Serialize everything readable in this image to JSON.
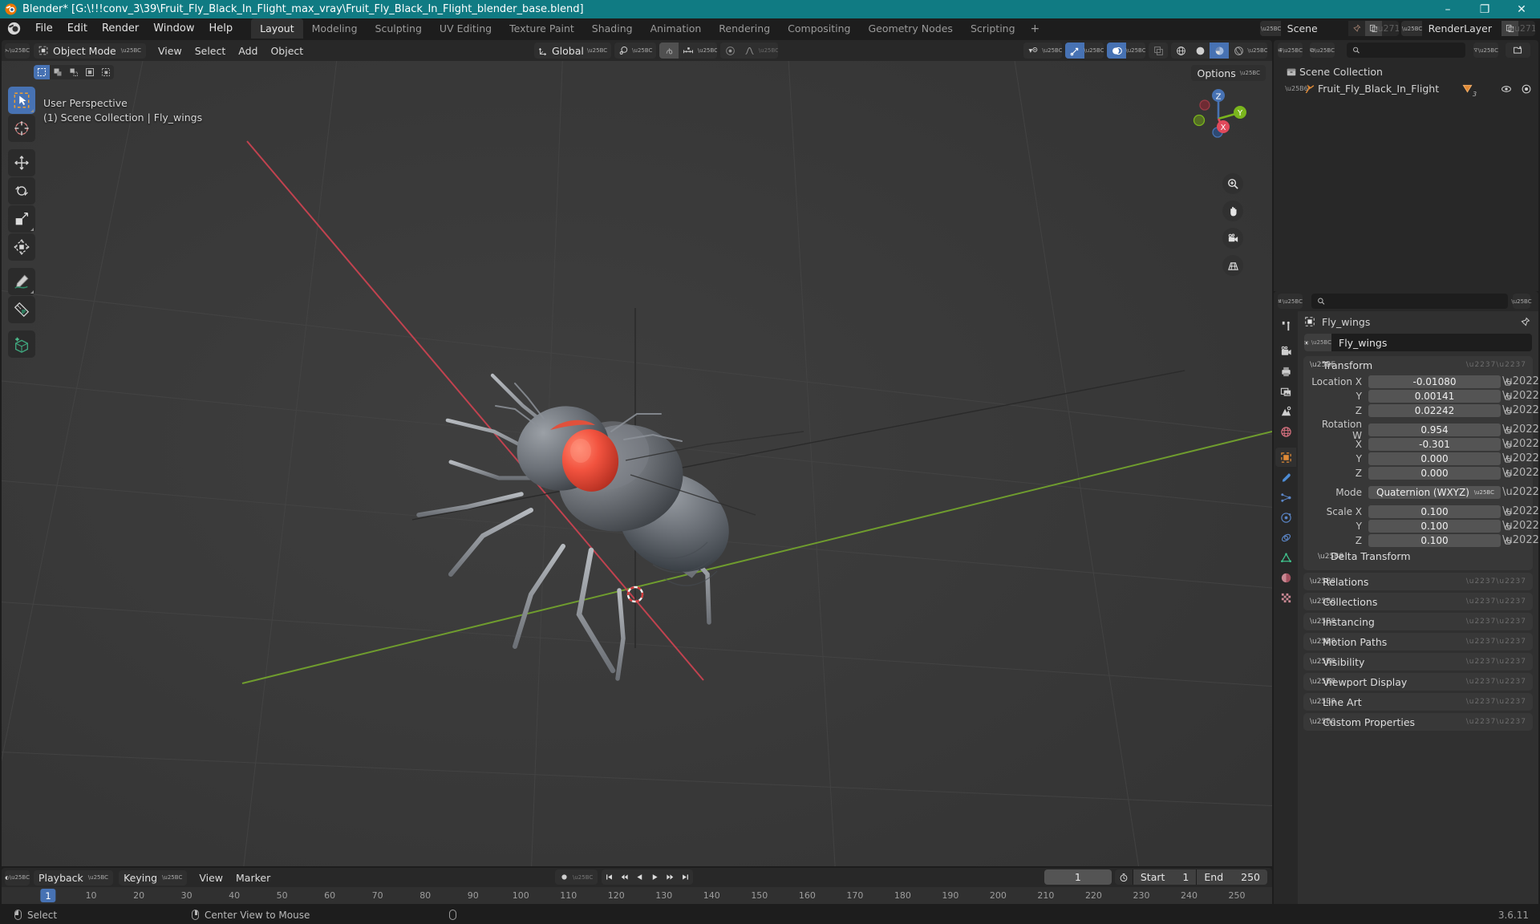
{
  "window": {
    "title": "Blender* [G:\\!!!conv_3\\39\\Fruit_Fly_Black_In_Flight_max_vray\\Fruit_Fly_Black_In_Flight_blender_base.blend]",
    "minimize": "–",
    "maximize": "❐",
    "close": "✕"
  },
  "topbar": {
    "menus": [
      "File",
      "Edit",
      "Render",
      "Window",
      "Help"
    ],
    "workspaces": [
      {
        "label": "Layout",
        "active": true
      },
      {
        "label": "Modeling",
        "active": false
      },
      {
        "label": "Sculpting",
        "active": false
      },
      {
        "label": "UV Editing",
        "active": false
      },
      {
        "label": "Texture Paint",
        "active": false
      },
      {
        "label": "Shading",
        "active": false
      },
      {
        "label": "Animation",
        "active": false
      },
      {
        "label": "Rendering",
        "active": false
      },
      {
        "label": "Compositing",
        "active": false
      },
      {
        "label": "Geometry Nodes",
        "active": false
      },
      {
        "label": "Scripting",
        "active": false
      }
    ],
    "add_workspace": "+",
    "scene": {
      "name": "Scene",
      "new_icon": "duplicate-icon",
      "unlink_icon": "x-icon"
    },
    "view_layer": {
      "name": "RenderLayer",
      "new_icon": "duplicate-icon",
      "unlink_icon": "x-icon"
    }
  },
  "viewport_header": {
    "mode": "Object Mode",
    "menus": [
      "View",
      "Select",
      "Add",
      "Object"
    ],
    "transform_orientation": "Global",
    "snapping_enabled": false,
    "proportional_editing": false,
    "options_label": "Options"
  },
  "viewport": {
    "perspective_label": "User Perspective",
    "context_label": "(1) Scene Collection | Fly_wings",
    "gizmo_axes": [
      {
        "label": "Z",
        "color": "#4772b3"
      },
      {
        "label": "Y",
        "color": "#7ab51d"
      },
      {
        "label": "X",
        "color": "#e0495b"
      }
    ],
    "nav_buttons": [
      "zoom-icon",
      "pan-hand-icon",
      "camera-view-icon",
      "toggle-ortho-icon"
    ],
    "select_modes": [
      "select-box-icon",
      "select-extend-icon",
      "select-subtract-icon",
      "select-invert-icon",
      "select-intersect-icon"
    ],
    "tools": [
      {
        "name": "tweak-select-box",
        "active": true
      },
      {
        "name": "cursor",
        "active": false
      },
      {
        "name": "move",
        "active": false
      },
      {
        "name": "rotate",
        "active": false
      },
      {
        "name": "scale",
        "active": false
      },
      {
        "name": "transform",
        "active": false
      },
      {
        "name": "annotate",
        "active": false
      },
      {
        "name": "measure",
        "active": false
      },
      {
        "name": "add-cube",
        "active": false
      }
    ],
    "shading_modes": [
      "wireframe",
      "solid",
      "material-preview",
      "rendered"
    ],
    "active_shading_mode": "material-preview"
  },
  "timeline": {
    "editor_menus": [
      "Playback",
      "Keying",
      "View",
      "Marker"
    ],
    "auto_key_label": "record-icon",
    "playback_buttons": [
      "jump-start-icon",
      "prev-keyframe-icon",
      "play-reverse-icon",
      "play-icon",
      "next-keyframe-icon",
      "jump-end-icon"
    ],
    "current_frame": "1",
    "start_label": "Start",
    "start_value": "1",
    "end_label": "End",
    "end_value": "250",
    "ticks": [
      10,
      20,
      30,
      40,
      50,
      60,
      70,
      80,
      90,
      100,
      110,
      120,
      130,
      140,
      150,
      160,
      170,
      180,
      190,
      200,
      210,
      220,
      230,
      240,
      250
    ],
    "playhead_frame": "1"
  },
  "outliner": {
    "display_mode": "View Layer",
    "search_placeholder": "",
    "filter_icon": "funnel-icon",
    "new_collection_icon": "new-collection-icon",
    "rows": [
      {
        "label": "Scene Collection",
        "icon": "collection-icon",
        "indent": 0,
        "expandable": false
      },
      {
        "label": "Fruit_Fly_Black_In_Flight",
        "icon": "armature-icon",
        "indent": 1,
        "expandable": true,
        "badge": "3",
        "visible_icon": "eye-icon",
        "render_icon": "camera-icon"
      }
    ]
  },
  "properties": {
    "search_placeholder": "",
    "tabs": [
      {
        "name": "tool",
        "active": false
      },
      {
        "name": "render",
        "active": false
      },
      {
        "name": "output",
        "active": false
      },
      {
        "name": "view-layer",
        "active": false
      },
      {
        "name": "scene",
        "active": false
      },
      {
        "name": "world",
        "active": false
      },
      {
        "name": "object",
        "active": true
      },
      {
        "name": "modifiers",
        "active": false
      },
      {
        "name": "particles",
        "active": false
      },
      {
        "name": "physics",
        "active": false
      },
      {
        "name": "constraints",
        "active": false
      },
      {
        "name": "object-data",
        "active": false
      },
      {
        "name": "material",
        "active": false
      },
      {
        "name": "texture",
        "active": false
      }
    ],
    "breadcrumb_object": "Fly_wings",
    "id_name": "Fly_wings",
    "transform": {
      "title": "Transform",
      "rows": [
        {
          "label": "Location X",
          "value": "-0.01080"
        },
        {
          "label": "Y",
          "value": "0.00141"
        },
        {
          "label": "Z",
          "value": "0.02242"
        }
      ],
      "rotation_rows": [
        {
          "label": "Rotation W",
          "value": "0.954"
        },
        {
          "label": "X",
          "value": "-0.301"
        },
        {
          "label": "Y",
          "value": "0.000"
        },
        {
          "label": "Z",
          "value": "0.000"
        }
      ],
      "mode_label": "Mode",
      "mode_value": "Quaternion (WXYZ)",
      "scale_rows": [
        {
          "label": "Scale X",
          "value": "0.100"
        },
        {
          "label": "Y",
          "value": "0.100"
        },
        {
          "label": "Z",
          "value": "0.100"
        }
      ],
      "delta_transform": "Delta Transform"
    },
    "panels": [
      {
        "label": "Relations"
      },
      {
        "label": "Collections"
      },
      {
        "label": "Instancing"
      },
      {
        "label": "Motion Paths"
      },
      {
        "label": "Visibility"
      },
      {
        "label": "Viewport Display"
      },
      {
        "label": "Line Art"
      },
      {
        "label": "Custom Properties"
      }
    ]
  },
  "statusbar": {
    "items": [
      {
        "icon": "mouse-left-icon",
        "label": "Select"
      },
      {
        "icon": "mouse-middle-icon",
        "label": "Center View to Mouse"
      },
      {
        "icon": "mouse-right-icon",
        "label": ""
      }
    ],
    "version": "3.6.11"
  },
  "colors": {
    "accent_blue": "#4772b3",
    "title_teal": "#107b83",
    "object_orange": "#e08a36",
    "axis_x": "#c1424f",
    "axis_y": "#6f9c2e"
  }
}
